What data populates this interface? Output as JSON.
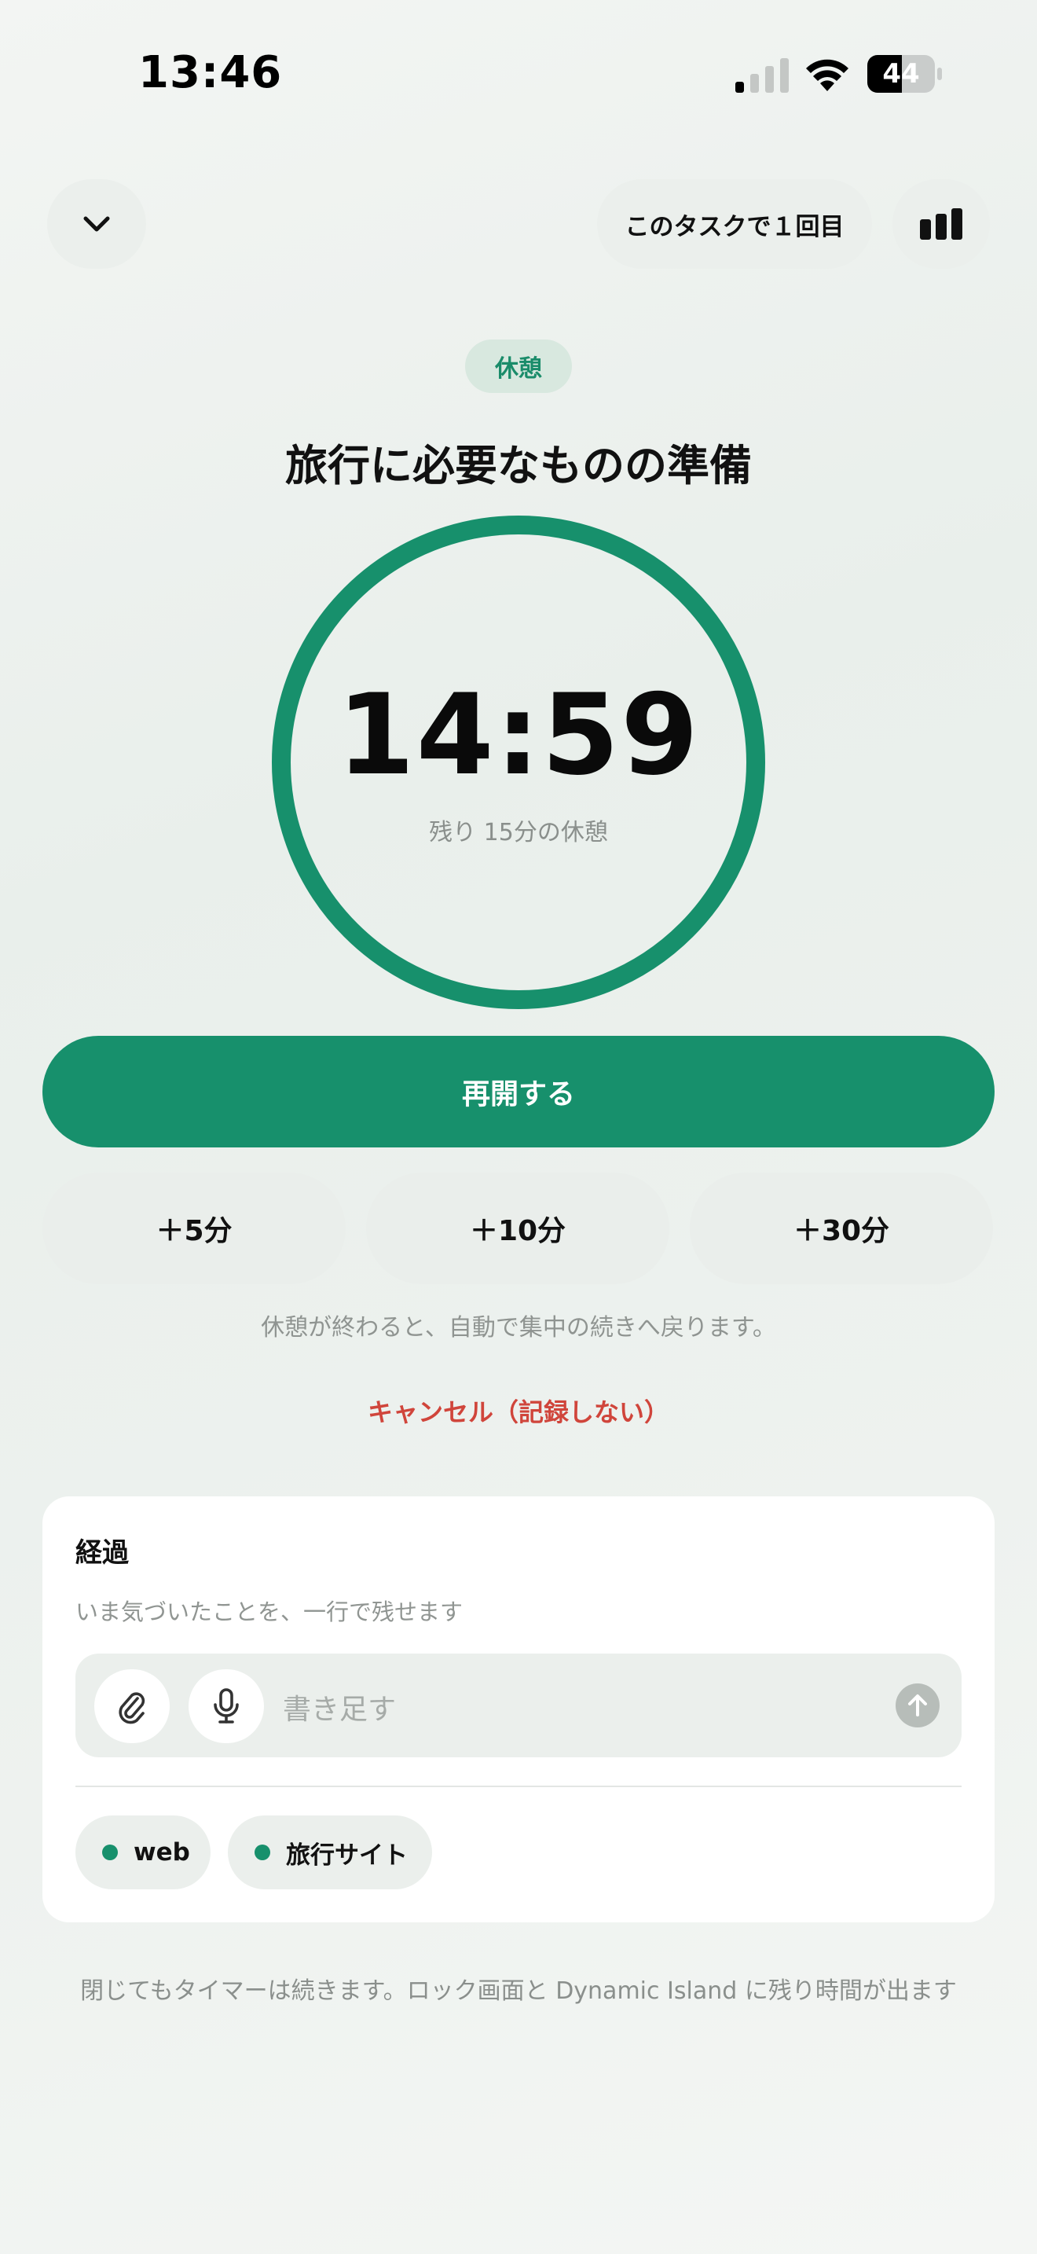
{
  "status_bar": {
    "time": "13:46",
    "battery": "44"
  },
  "header": {
    "session_label": "このタスクで１回目"
  },
  "mode": {
    "label": "休憩"
  },
  "task": {
    "title": "旅行に必要なものの準備"
  },
  "timer": {
    "display": "14:59",
    "subtitle": "残り 15分の休憩",
    "progress": 1.0
  },
  "actions": {
    "resume_label": "再開する",
    "add_options": [
      "＋5分",
      "＋10分",
      "＋30分"
    ],
    "hint": "休憩が終わると、自動で集中の続きへ戻ります。",
    "cancel_label": "キャンセル（記録しない）"
  },
  "notes_card": {
    "title": "経過",
    "subtitle": "いま気づいたことを、一行で残せます",
    "input_placeholder": "書き足す",
    "tags": [
      "web",
      "旅行サイト"
    ]
  },
  "footer": {
    "text": "閉じてもタイマーは続きます。ロック画面と Dynamic Island に残り時間が出ます"
  },
  "colors": {
    "accent": "#17906c",
    "cancel": "#d0453b",
    "mode_pill_bg": "#d8e8df"
  }
}
